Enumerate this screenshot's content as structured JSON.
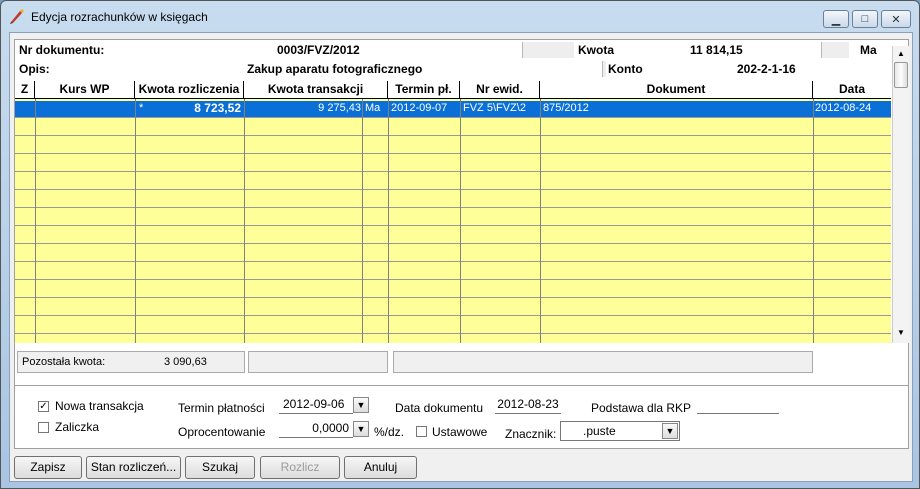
{
  "window": {
    "title": "Edycja rozrachunków w księgach"
  },
  "info": {
    "nr_label": "Nr dokumentu:",
    "nr_value": "0003/FVZ/2012",
    "kwota_label": "Kwota",
    "kwota_value": "11 814,15",
    "ma_label": "Ma",
    "opis_label": "Opis:",
    "opis_value": "Zakup aparatu fotograficznego",
    "konto_label": "Konto",
    "konto_value": "202-2-1-16"
  },
  "grid": {
    "columns": [
      "Z",
      "Kurs WP",
      "Kwota rozliczenia",
      "Kwota transakcji",
      "Termin pł.",
      "Nr ewid.",
      "Dokument",
      "Data"
    ],
    "row": {
      "z": "",
      "kurs": "",
      "star": "*",
      "kwota_rozl": "8 723,52",
      "kwota_trans": "9 275,43",
      "strona": "Ma",
      "termin": "2012-09-07",
      "nr_ewid": "FVZ  5\\FVZ\\2",
      "dokument": "875/2012",
      "data": "2012-08-24"
    }
  },
  "status": {
    "pozostala_label": "Pozostała kwota:",
    "pozostala_value": "3 090,63"
  },
  "form": {
    "nowa_transakcja": "Nowa transakcja",
    "zaliczka": "Zaliczka",
    "termin_label": "Termin płatności",
    "termin_value": "2012-09-06",
    "oprocentowanie_label": "Oprocentowanie",
    "oprocentowanie_value": "0,0000",
    "procent_unit": "%/dz.",
    "ustawowe": "Ustawowe",
    "data_dok_label": "Data dokumentu",
    "data_dok_value": "2012-08-23",
    "podstawa_label": "Podstawa dla RKP",
    "znacznik_label": "Znacznik:",
    "znacznik_value": ".puste"
  },
  "buttons": {
    "zapisz": "Zapisz",
    "stan": "Stan rozliczeń...",
    "szukaj": "Szukaj",
    "rozlicz": "Rozlicz",
    "anuluj": "Anuluj"
  }
}
